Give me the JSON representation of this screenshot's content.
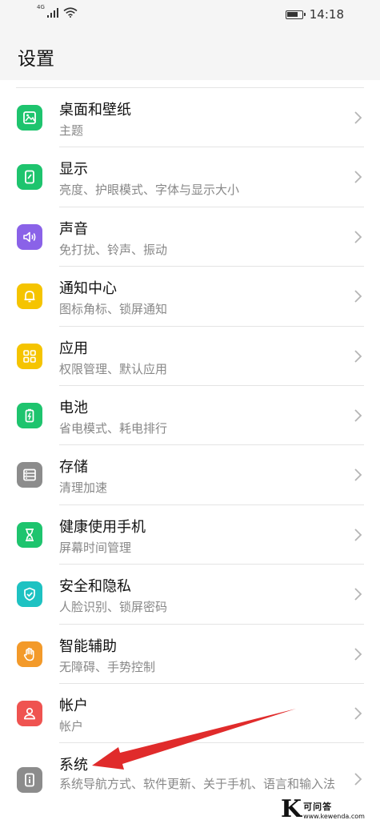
{
  "status_bar": {
    "network": "4G",
    "signal_bars": 4,
    "battery_level": 0.8,
    "time": "14:18"
  },
  "header": {
    "title": "设置"
  },
  "colors": {
    "wallpaper": "#1ec46e",
    "display": "#1ec46e",
    "sound": "#8a62e8",
    "notification": "#f5c400",
    "apps": "#f5c400",
    "battery": "#1ec46e",
    "storage": "#8c8c8c",
    "wellbeing": "#1ec46e",
    "security": "#1ec2c2",
    "assist": "#f39a2a",
    "account": "#ef5350",
    "system": "#8c8c8c",
    "arrow": "#e02b2b"
  },
  "settings": {
    "items": [
      {
        "id": "wallpaper",
        "icon": "image-icon",
        "title": "桌面和壁纸",
        "subtitle": "主题"
      },
      {
        "id": "display",
        "icon": "phone-brightness-icon",
        "title": "显示",
        "subtitle": "亮度、护眼模式、字体与显示大小"
      },
      {
        "id": "sound",
        "icon": "speaker-icon",
        "title": "声音",
        "subtitle": "免打扰、铃声、振动"
      },
      {
        "id": "notification",
        "icon": "bell-icon",
        "title": "通知中心",
        "subtitle": "图标角标、锁屏通知"
      },
      {
        "id": "apps",
        "icon": "grid-icon",
        "title": "应用",
        "subtitle": "权限管理、默认应用"
      },
      {
        "id": "battery",
        "icon": "battery-icon",
        "title": "电池",
        "subtitle": "省电模式、耗电排行"
      },
      {
        "id": "storage",
        "icon": "storage-icon",
        "title": "存储",
        "subtitle": "清理加速"
      },
      {
        "id": "wellbeing",
        "icon": "hourglass-icon",
        "title": "健康使用手机",
        "subtitle": "屏幕时间管理"
      },
      {
        "id": "security",
        "icon": "shield-icon",
        "title": "安全和隐私",
        "subtitle": "人脸识别、锁屏密码"
      },
      {
        "id": "assist",
        "icon": "hand-icon",
        "title": "智能辅助",
        "subtitle": "无障碍、手势控制"
      },
      {
        "id": "account",
        "icon": "person-icon",
        "title": "帐户",
        "subtitle": "帐户"
      },
      {
        "id": "system",
        "icon": "info-icon",
        "title": "系统",
        "subtitle": "系统导航方式、软件更新、关于手机、语言和输入法"
      }
    ]
  },
  "watermark": {
    "logo": "K",
    "name": "可问答",
    "url": "www.kewenda.com"
  }
}
